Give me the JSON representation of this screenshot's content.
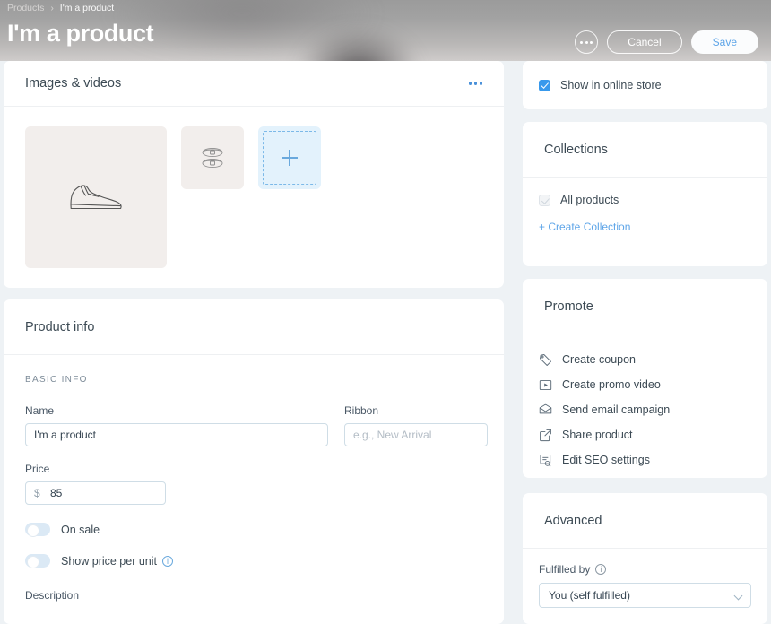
{
  "header": {
    "breadcrumb": {
      "root": "Products",
      "separator": "›",
      "current": "I'm a product"
    },
    "title": "I'm a product",
    "more_label": "…",
    "cancel_label": "Cancel",
    "save_label": "Save",
    "accent_save_color": "#5ea5e8"
  },
  "media": {
    "title": "Images & videos",
    "menu_icon": "more-horizontal-icon",
    "items": [
      {
        "icon": "shoe-side-icon",
        "alt": "Shoe side view"
      },
      {
        "icon": "shoes-pair-icon",
        "alt": "Pair of shoes top view"
      }
    ],
    "add_tile": {
      "icon": "plus-icon",
      "label": ""
    }
  },
  "product_info": {
    "title": "Product info",
    "section_label": "BASIC INFO",
    "name": {
      "label": "Name",
      "value": "I'm a product",
      "placeholder": ""
    },
    "ribbon": {
      "label": "Ribbon",
      "value": "",
      "placeholder": "e.g., New Arrival"
    },
    "price": {
      "label": "Price",
      "currency_symbol": "$",
      "value": "85",
      "placeholder": ""
    },
    "on_sale": {
      "label": "On sale",
      "enabled": false
    },
    "price_per_unit": {
      "label": "Show price per unit",
      "enabled": false,
      "info_icon": "info-icon"
    },
    "description": {
      "label": "Description"
    }
  },
  "sidebar": {
    "online_store": {
      "label": "Show in online store",
      "checked": true,
      "checkbox_color": "#3899ec"
    },
    "collections": {
      "title": "Collections",
      "items": [
        {
          "label": "All products",
          "checked": true,
          "disabled": true
        }
      ],
      "create_link": "+ Create Collection"
    },
    "promote": {
      "title": "Promote",
      "items": [
        {
          "label": "Create coupon",
          "icon": "coupon-icon"
        },
        {
          "label": "Create promo video",
          "icon": "video-play-icon"
        },
        {
          "label": "Send email campaign",
          "icon": "envelope-icon"
        },
        {
          "label": "Share product",
          "icon": "share-icon"
        },
        {
          "label": "Edit SEO settings",
          "icon": "seo-icon"
        }
      ]
    },
    "advanced": {
      "title": "Advanced",
      "fulfilled_by": {
        "label": "Fulfilled by",
        "info_icon": "info-icon",
        "value": "You (self fulfilled)",
        "options": [
          "You (self fulfilled)"
        ]
      }
    }
  }
}
